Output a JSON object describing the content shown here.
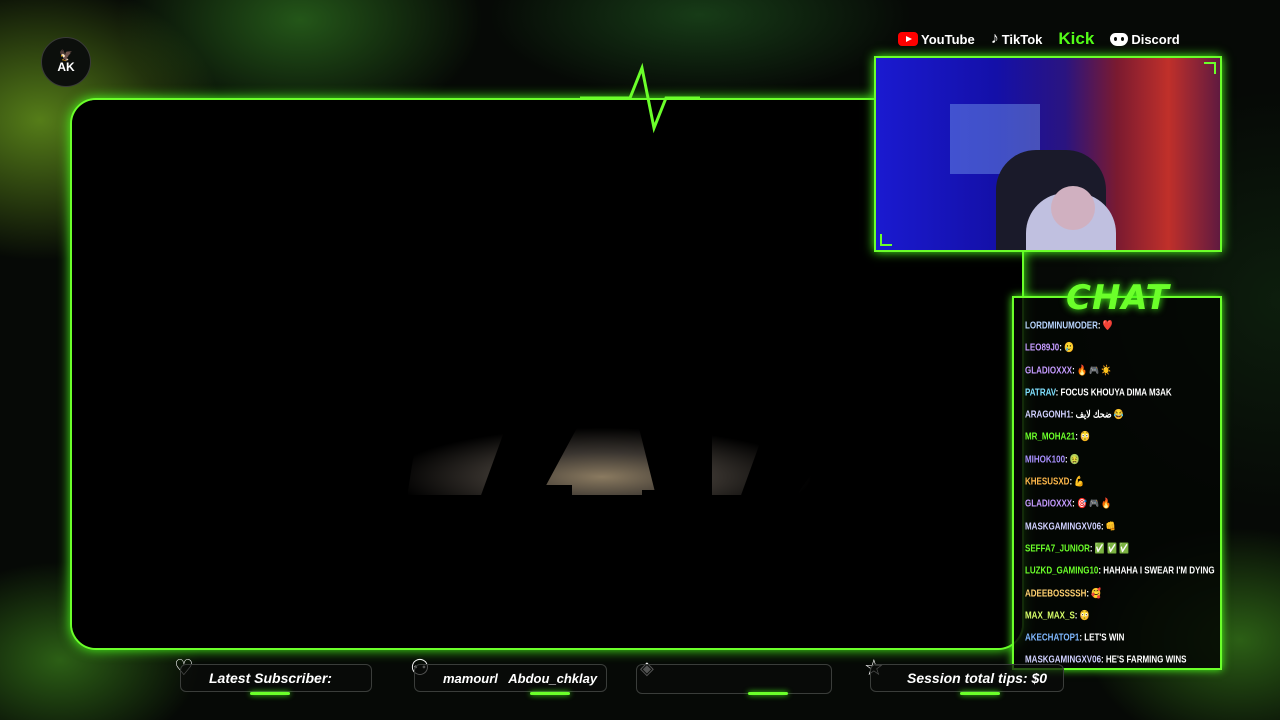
{
  "logo": {
    "text": "AK",
    "subtext": ""
  },
  "socials": [
    {
      "label": "YouTube",
      "icon": "youtube-icon"
    },
    {
      "label": "TikTok",
      "icon": "tiktok-icon"
    },
    {
      "label": "Kick",
      "icon": "kick-wordmark"
    },
    {
      "label": "Discord",
      "icon": "discord-icon"
    }
  ],
  "chat": {
    "title": "CHAT",
    "messages": [
      {
        "user": "lordminumoder",
        "text": ": ❤️",
        "color": "#b9d6ff"
      },
      {
        "user": "leo89j0",
        "text": ": 🥲",
        "color": "#c59bff"
      },
      {
        "user": "gladioxxx",
        "text": ": 🔥 🎮 ☀️",
        "color": "#c59bff"
      },
      {
        "user": "patrav",
        "text": ": FOCUS KHOUYA DIMA M3AK",
        "color": "#7fe0ff"
      },
      {
        "user": "aragonh1",
        "text": ": ضحك لايف 😂",
        "color": "#d0d0ff"
      },
      {
        "user": "mr_moha21",
        "text": ": 😳",
        "color": "#6bff2a"
      },
      {
        "user": "mihok100",
        "text": ": 🤢",
        "color": "#a890ff"
      },
      {
        "user": "khesusxd",
        "text": ": 💪",
        "color": "#ffb84a"
      },
      {
        "user": "gladioxxx",
        "text": ": 🎯 🎮 🔥",
        "color": "#c59bff"
      },
      {
        "user": "maskgamingxv06",
        "text": ": 👊",
        "color": "#d0d0ff"
      },
      {
        "user": "seffa7_junior",
        "text": ": ✅ ✅ ✅",
        "color": "#6bff2a"
      },
      {
        "user": "luzkd_gaming10",
        "text": ": HAHAHA I SWEAR I'M DYING",
        "color": "#6bff2a"
      },
      {
        "user": "adeebossssh",
        "text": ": 🥰",
        "color": "#ffd070"
      },
      {
        "user": "max_max_s",
        "text": ": 😳",
        "color": "#d8ff6a"
      },
      {
        "user": "akechatop1",
        "text": ": LET'S WIN",
        "color": "#7fb8ff"
      },
      {
        "user": "maskgamingxv06",
        "text": ": HE'S FARMING WINS",
        "color": "#d0d0ff"
      }
    ]
  },
  "bottom_bar": {
    "latest_subscriber_label": "Latest Subscriber:",
    "follower_names": "mamourl   Abdou_chklay",
    "session_tips": "Session total tips: $0"
  },
  "colors": {
    "accent": "#6bff2a",
    "kick": "#53fc18"
  }
}
